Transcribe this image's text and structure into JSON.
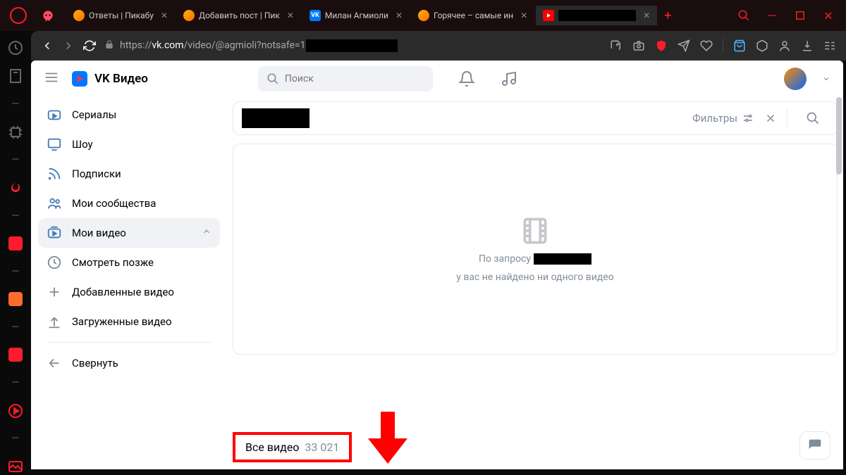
{
  "tabs": [
    {
      "label": "Ответы | Пикабу",
      "favicon": "pikabu"
    },
    {
      "label": "Добавить пост | Пик",
      "favicon": "pikabu"
    },
    {
      "label": "Милан Агмиоли",
      "favicon": "vk"
    },
    {
      "label": "Горячее – самые ин",
      "favicon": "pikabu"
    },
    {
      "label": "",
      "favicon": "youtube",
      "active": true
    }
  ],
  "url": {
    "prefix": "https://",
    "domain": "vk.com",
    "path": "/video/@agmioli?notsafe=1"
  },
  "vk": {
    "brand": "VK Видео",
    "search_placeholder": "Поиск",
    "sidebar": [
      {
        "icon": "tv",
        "label": "Сериалы"
      },
      {
        "icon": "monitor",
        "label": "Шоу"
      },
      {
        "icon": "rss",
        "label": "Подписки"
      },
      {
        "icon": "group",
        "label": "Мои сообщества"
      },
      {
        "icon": "video",
        "label": "Мои видео",
        "active": true,
        "chevron": true
      },
      {
        "icon": "clock",
        "label": "Смотреть позже"
      },
      {
        "icon": "plus",
        "label": "Добавленные видео"
      },
      {
        "icon": "upload",
        "label": "Загруженные видео"
      },
      {
        "divider": true
      },
      {
        "icon": "back",
        "label": "Свернуть"
      }
    ],
    "filters_label": "Фильтры",
    "empty": {
      "line1_prefix": "По запросу",
      "line2": "у вас не найдено ни одного видео"
    },
    "all_videos": {
      "label": "Все видео",
      "count": "33 021"
    }
  }
}
